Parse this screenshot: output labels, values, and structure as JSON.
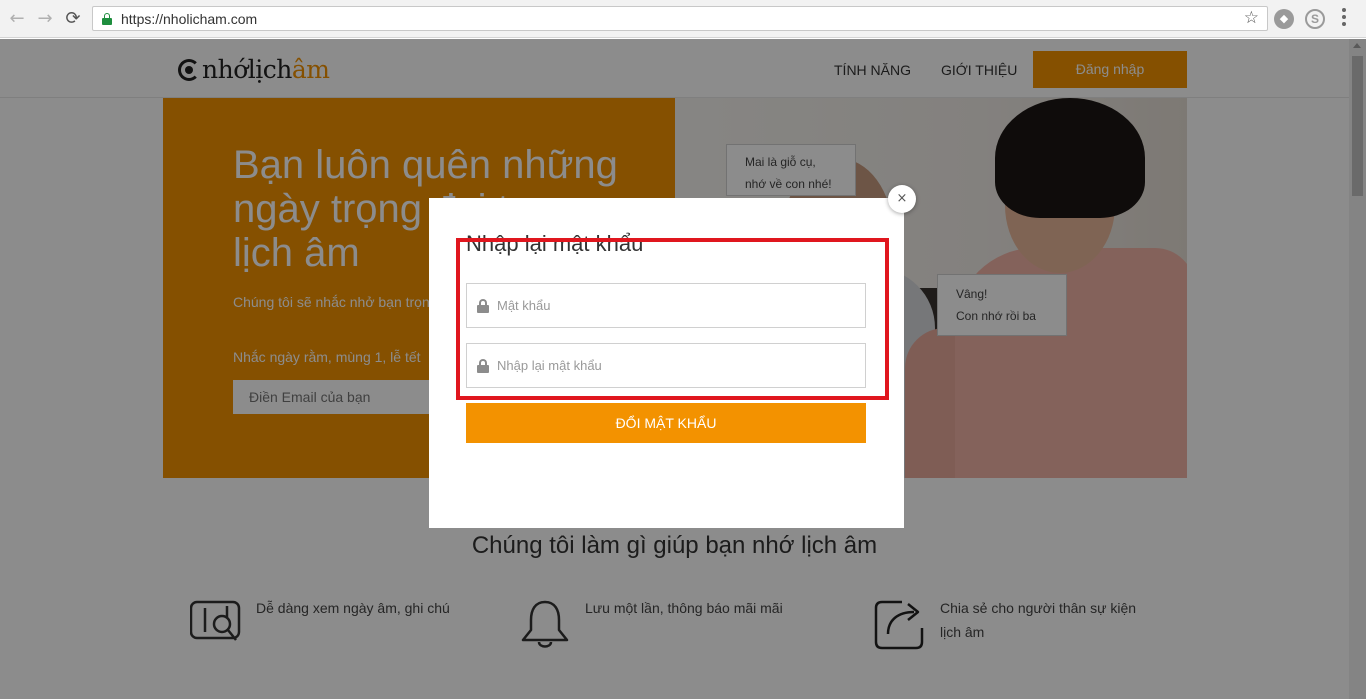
{
  "browser": {
    "url": "https://nholicham.com",
    "back_icon": "←",
    "forward_icon": "→",
    "reload_icon": "⟳",
    "star_icon": "☆"
  },
  "header": {
    "logo_prefix": "nhớlịch",
    "logo_suffix": "âm",
    "nav": [
      "TÍNH NĂNG",
      "GIỚI THIỆU"
    ],
    "login_label": "Đăng nhập"
  },
  "hero": {
    "title": "Bạn luôn quên những ngày trọng đại trong lịch âm",
    "subtitle": "Chúng tôi sẽ nhắc nhở bạn trọn đời",
    "remind": "Nhắc ngày rằm, mùng 1, lễ tết",
    "email_placeholder": "Điền Email của bạn",
    "bubble1_line1": "Mai là giỗ cụ,",
    "bubble1_line2": "nhớ về con nhé!",
    "bubble2_line1": "Vâng!",
    "bubble2_line2": "Con nhớ rồi ba"
  },
  "features": {
    "title": "Chúng tôi làm gì giúp bạn nhớ lịch âm",
    "items": [
      {
        "text": "Dễ dàng xem ngày âm, ghi chú",
        "icon": "calendar-search-icon"
      },
      {
        "text": "Lưu một lần, thông báo mãi mãi",
        "icon": "bell-icon"
      },
      {
        "text": "Chia sẻ cho người thân sự kiện lịch âm",
        "icon": "share-icon"
      }
    ]
  },
  "modal": {
    "title": "Nhập lại mật khẩu",
    "password_placeholder": "Mật khẩu",
    "confirm_placeholder": "Nhập lại mật khẩu",
    "submit_label": "ĐỔI MẬT KHẨU",
    "close_icon": "×"
  },
  "colors": {
    "accent": "#f39200",
    "highlight": "#e0161e"
  }
}
